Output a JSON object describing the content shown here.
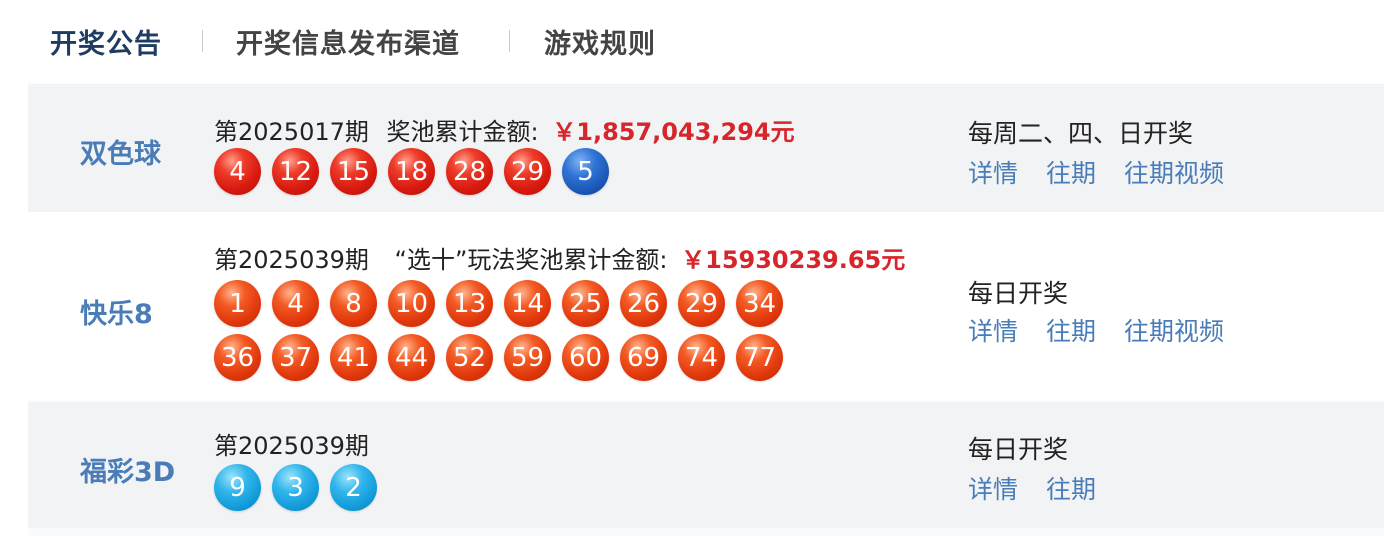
{
  "tabs": [
    {
      "label": "开奖公告",
      "active": true
    },
    {
      "label": "开奖信息发布渠道",
      "active": false
    },
    {
      "label": "游戏规则",
      "active": false
    }
  ],
  "games": [
    {
      "name": "双色球",
      "issue": "第2025017期",
      "pool_label": "奖池累计金额:",
      "pool_amount": "￥1,857,043,294元",
      "red_balls": [
        "4",
        "12",
        "15",
        "18",
        "28",
        "29"
      ],
      "blue_balls": [
        "5"
      ],
      "schedule": "每周二、四、日开奖",
      "links": [
        "详情",
        "往期",
        "往期视频"
      ]
    },
    {
      "name": "快乐8",
      "issue": "第2025039期",
      "pool_label": "“选十”玩法奖池累计金额:",
      "pool_amount": "￥15930239.65元",
      "balls_row1": [
        "1",
        "4",
        "8",
        "10",
        "13",
        "14",
        "25",
        "26",
        "29",
        "34"
      ],
      "balls_row2": [
        "36",
        "37",
        "41",
        "44",
        "52",
        "59",
        "60",
        "69",
        "74",
        "77"
      ],
      "schedule": "每日开奖",
      "links": [
        "详情",
        "往期",
        "往期视频"
      ]
    },
    {
      "name": "福彩3D",
      "issue": "第2025039期",
      "balls": [
        "9",
        "3",
        "2"
      ],
      "schedule": "每日开奖",
      "links": [
        "详情",
        "往期"
      ]
    }
  ],
  "colors": {
    "accent_blue": "#4a7db8",
    "prize_red": "#d7262b",
    "ball_red": "#d81a10",
    "ball_blue": "#1a55b4",
    "ball_cyan": "#119ad8",
    "ball_orange": "#e0370c"
  }
}
